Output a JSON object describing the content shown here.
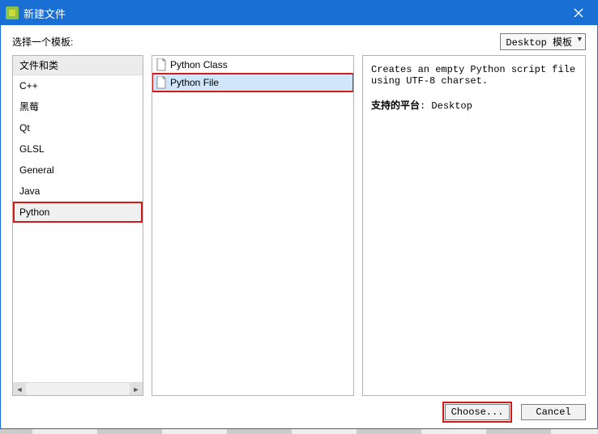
{
  "title": "新建文件",
  "prompt": "选择一个模板:",
  "filter": {
    "label": "Desktop 模板"
  },
  "categories": {
    "header": "文件和类",
    "items": [
      {
        "label": "C++",
        "selected": false
      },
      {
        "label": "黑莓",
        "selected": false
      },
      {
        "label": "Qt",
        "selected": false
      },
      {
        "label": "GLSL",
        "selected": false
      },
      {
        "label": "General",
        "selected": false
      },
      {
        "label": "Java",
        "selected": false
      },
      {
        "label": "Python",
        "selected": true
      }
    ]
  },
  "templates": {
    "items": [
      {
        "label": "Python Class",
        "selected": false
      },
      {
        "label": "Python File",
        "selected": true
      }
    ]
  },
  "description": {
    "text": "Creates an empty Python script file using UTF-8 charset.",
    "platform_label": "支持的平台",
    "platform_value": "Desktop"
  },
  "buttons": {
    "choose": "Choose...",
    "cancel": "Cancel"
  }
}
